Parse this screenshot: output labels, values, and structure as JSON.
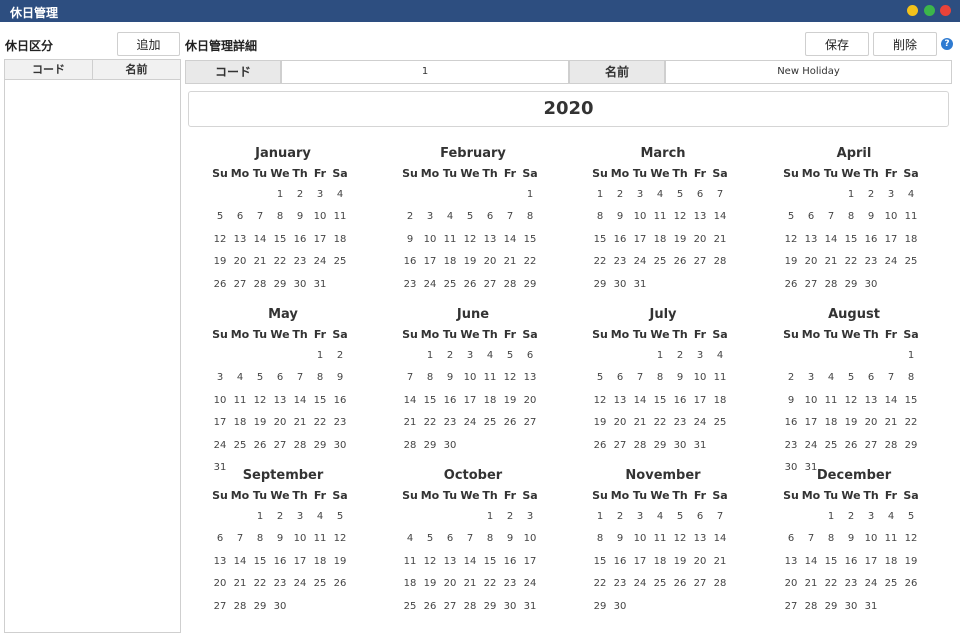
{
  "window": {
    "title": "休日管理"
  },
  "left": {
    "section_label": "休日区分",
    "add_label": "追加",
    "columns": [
      "コード",
      "名前"
    ]
  },
  "detail": {
    "section_label": "休日管理詳細",
    "save_label": "保存",
    "delete_label": "削除",
    "help_glyph": "?",
    "code_label": "コード",
    "code_value": "1",
    "name_label": "名前",
    "name_value": "New Holiday"
  },
  "calendar": {
    "year": "2020",
    "weekdays": [
      "Su",
      "Mo",
      "Tu",
      "We",
      "Th",
      "Fr",
      "Sa"
    ],
    "months": [
      {
        "name": "January",
        "start": 3,
        "days": 31
      },
      {
        "name": "February",
        "start": 6,
        "days": 29
      },
      {
        "name": "March",
        "start": 0,
        "days": 31
      },
      {
        "name": "April",
        "start": 3,
        "days": 30
      },
      {
        "name": "May",
        "start": 5,
        "days": 31
      },
      {
        "name": "June",
        "start": 1,
        "days": 30
      },
      {
        "name": "July",
        "start": 3,
        "days": 31
      },
      {
        "name": "August",
        "start": 6,
        "days": 31
      },
      {
        "name": "September",
        "start": 2,
        "days": 30
      },
      {
        "name": "October",
        "start": 4,
        "days": 31
      },
      {
        "name": "November",
        "start": 0,
        "days": 30
      },
      {
        "name": "December",
        "start": 2,
        "days": 31
      }
    ]
  },
  "colors": {
    "titlebar": "#2d4e80",
    "help": "#2f7bd1"
  }
}
